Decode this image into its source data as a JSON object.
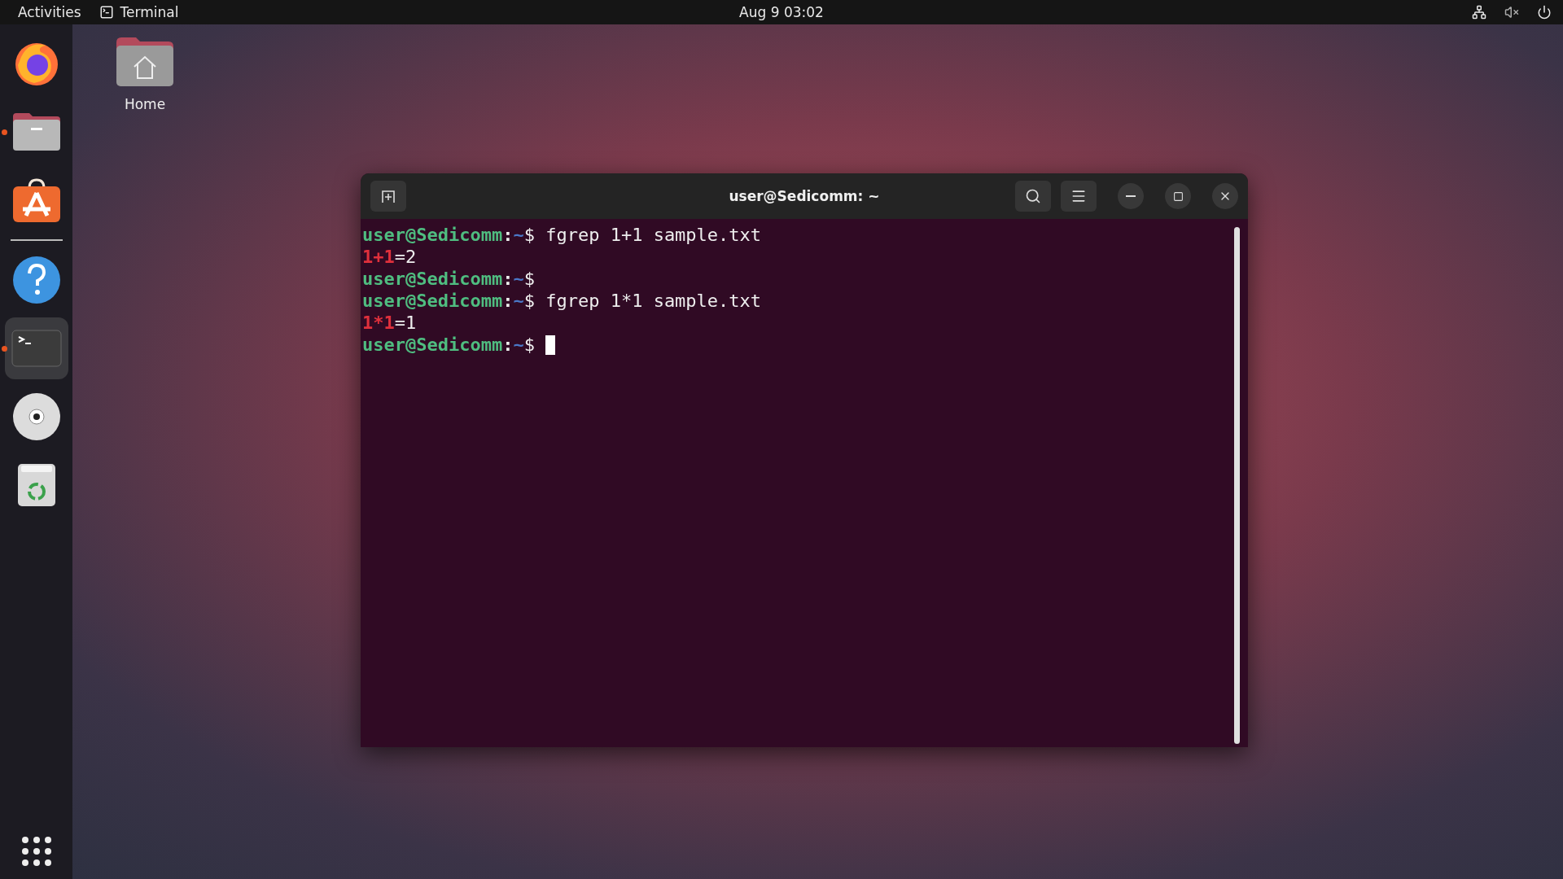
{
  "top_bar": {
    "activities": "Activities",
    "app_menu": "Terminal",
    "clock": "Aug 9  03:02"
  },
  "dock": {
    "items": [
      {
        "kind": "browser",
        "running": false,
        "selected": false
      },
      {
        "kind": "files",
        "running": true,
        "selected": false
      },
      {
        "kind": "store",
        "running": false,
        "selected": false
      },
      {
        "kind": "separator"
      },
      {
        "kind": "help",
        "running": false,
        "selected": false
      },
      {
        "kind": "terminal",
        "running": true,
        "selected": true
      },
      {
        "kind": "disc",
        "running": false,
        "selected": false
      },
      {
        "kind": "trash",
        "running": false,
        "selected": false
      }
    ]
  },
  "desktop_icons": [
    {
      "label": "Home"
    }
  ],
  "window": {
    "title": "user@Sedicomm: ~",
    "lines": [
      {
        "kind": "prompt",
        "user_host": "user@Sedicomm",
        "separator": ":",
        "path": "~",
        "symbol": "$",
        "command": " fgrep 1+1 sample.txt",
        "cursor": false
      },
      {
        "kind": "output",
        "match": "1+1",
        "rest": "=2"
      },
      {
        "kind": "prompt",
        "user_host": "user@Sedicomm",
        "separator": ":",
        "path": "~",
        "symbol": "$",
        "cursor": false
      },
      {
        "kind": "prompt",
        "user_host": "user@Sedicomm",
        "separator": ":",
        "path": "~",
        "symbol": "$",
        "command": " fgrep 1*1 sample.txt",
        "cursor": false
      },
      {
        "kind": "output",
        "match": "1*1",
        "rest": "=1"
      },
      {
        "kind": "prompt",
        "user_host": "user@Sedicomm",
        "separator": ":",
        "path": "~",
        "symbol": "$",
        "cursor": true
      }
    ]
  }
}
